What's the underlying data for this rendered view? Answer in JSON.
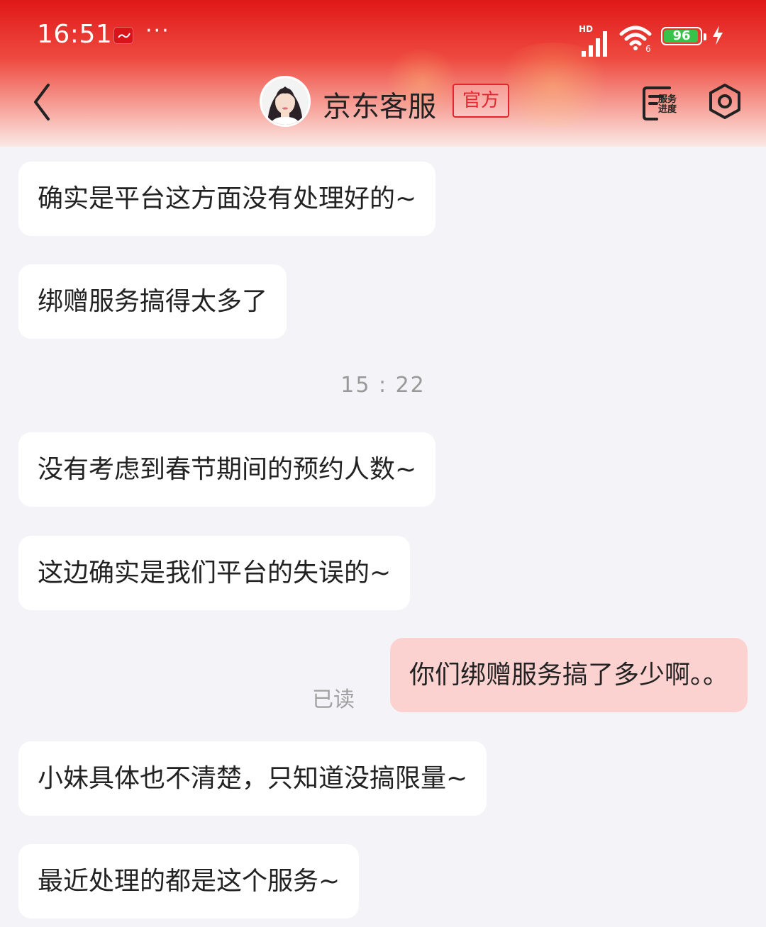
{
  "status_bar": {
    "time": "16:51",
    "network_badge": "HD",
    "battery_level": "96",
    "battery_fraction": 0.96,
    "icons": [
      "app-notification-icon",
      "more-dots-icon",
      "signal-icon",
      "wifi-icon",
      "battery-icon",
      "charging-icon"
    ]
  },
  "header": {
    "title": "京东客服",
    "badge": "官方",
    "service_progress_label_1": "服务",
    "service_progress_label_2": "进度",
    "icons": [
      "back-icon",
      "avatar",
      "service-progress-icon",
      "settings-icon"
    ],
    "accent_color": "#e3262e"
  },
  "messages": [
    {
      "side": "left",
      "text": "确实是平台这方面没有处理好的~"
    },
    {
      "side": "left",
      "text": "绑赠服务搞得太多了"
    },
    {
      "side": "left",
      "text": "没有考虑到春节期间的预约人数~"
    },
    {
      "side": "left",
      "text": "这边确实是我们平台的失误的~"
    },
    {
      "side": "right",
      "text": "你们绑赠服务搞了多少啊。。"
    },
    {
      "side": "left",
      "text": "小妹具体也不清楚，只知道没搞限量~"
    },
    {
      "side": "left",
      "text": "最近处理的都是这个服务~"
    }
  ],
  "timestamp": "15 : 22",
  "read_receipt": "已读",
  "colors": {
    "header_top": "#e01818",
    "chat_background": "#f4f4f8",
    "incoming_bubble": "#ffffff",
    "outgoing_bubble": "#fcd2d0"
  }
}
